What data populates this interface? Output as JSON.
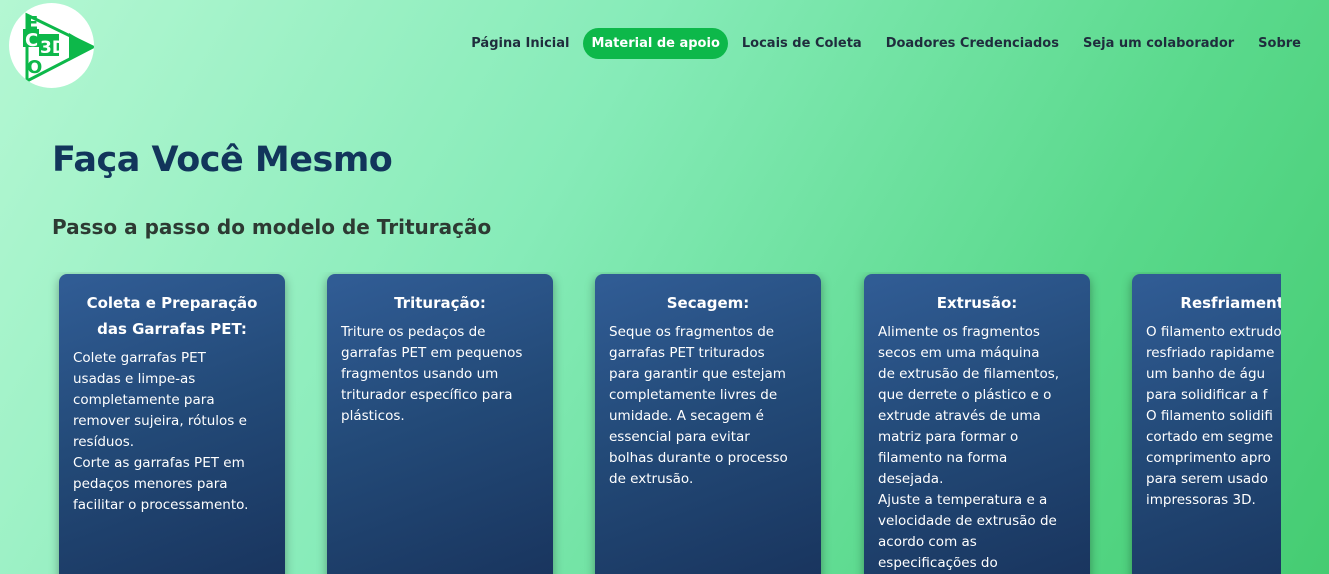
{
  "logo": {
    "letters": [
      "E",
      "C",
      "O",
      "3D"
    ]
  },
  "nav": {
    "items": [
      {
        "label": "Página Inicial"
      },
      {
        "label": "Material de apoio"
      },
      {
        "label": "Locais de Coleta"
      },
      {
        "label": "Doadores Credenciados"
      },
      {
        "label": "Seja um colaborador"
      },
      {
        "label": "Sobre"
      }
    ]
  },
  "main": {
    "title": "Faça Você Mesmo",
    "subtitle": "Passo a passo do modelo de Trituração"
  },
  "cards": [
    {
      "title": "Coleta e Preparação\ndas Garrafas PET:",
      "body": "Colete garrafas PET\nusadas e limpe-as\ncompletamente para\nremover sujeira, rótulos e\nresíduos.\nCorte as garrafas PET em\npedaços menores para\nfacilitar o processamento."
    },
    {
      "title": "Trituração:",
      "body": "Triture os pedaços de\ngarrafas PET em pequenos\nfragmentos usando um\ntriturador específico para\nplásticos."
    },
    {
      "title": "Secagem:",
      "body": "Seque os fragmentos de\ngarrafas PET triturados\npara garantir que estejam\ncompletamente livres de\numidade. A secagem é\nessencial para evitar\nbolhas durante o processo\nde extrusão."
    },
    {
      "title": "Extrusão:",
      "body": "Alimente os fragmentos\nsecos em uma máquina\nde extrusão de filamentos,\nque derrete o plástico e o\nextrude através de uma\nmatriz para formar o\nfilamento na forma\ndesejada.\nAjuste a temperatura e a\nvelocidade de extrusão de\nacordo com as\nespecificações do"
    },
    {
      "title": "Resfriamento e",
      "body": "O filamento extrudo\nresfriado rapidame\num banho de águ\npara solidificar a f\nO filamento solidifi\ncortado em segme\ncomprimento apro\npara serem usado\nimpressoras 3D."
    }
  ],
  "colors": {
    "accent": "#0db84a",
    "card": "#234a78",
    "title": "#12355b"
  }
}
